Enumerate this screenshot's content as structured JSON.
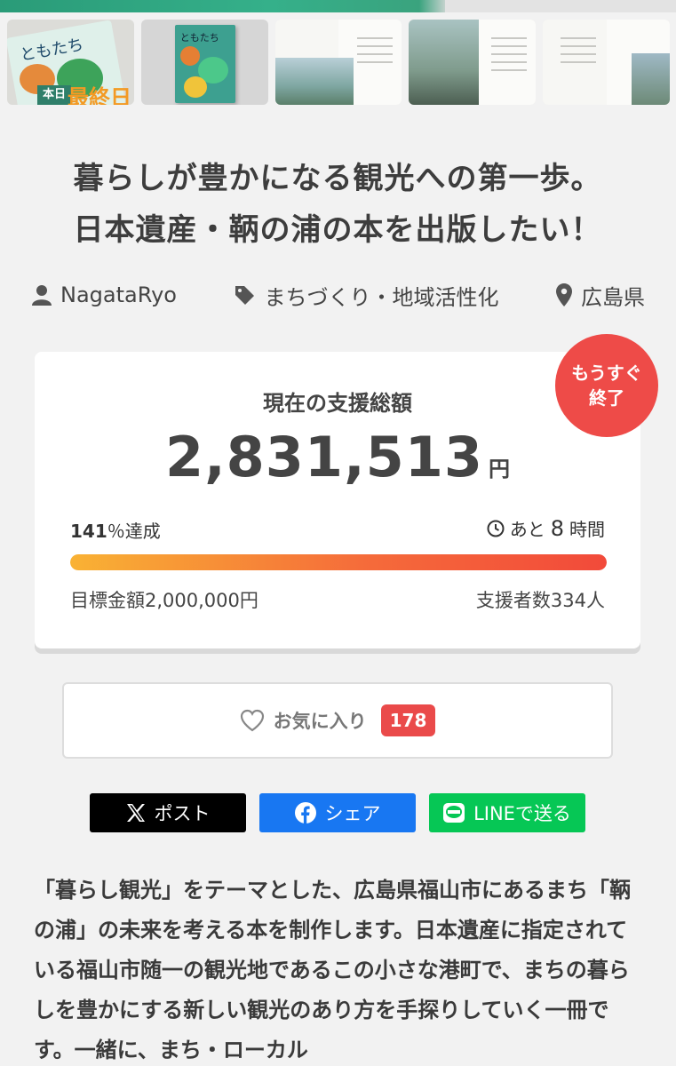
{
  "thumbnails": [
    {
      "title": "ともたち",
      "badge": "本日",
      "badge_big": "最終日"
    },
    {
      "title": "ともたち"
    },
    {},
    {},
    {}
  ],
  "title": {
    "line1": "暮らしが豊かになる観光への第一歩。",
    "line2": "日本遺産・鞆の浦の本を出版したい！"
  },
  "meta": {
    "author": "NagataRyo",
    "category": "まちづくり・地域活性化",
    "location": "広島県"
  },
  "funding": {
    "label": "現在の支援総額",
    "amount": "2,831,513",
    "unit": "円",
    "percent_value": "141",
    "percent_suffix": "％達成",
    "progress": 1.0,
    "remaining_prefix": "あと",
    "remaining_value": "8",
    "remaining_suffix": "時間",
    "goal": "目標金額2,000,000円",
    "backers": "支援者数334人",
    "ending_badge_line1": "もうすぐ",
    "ending_badge_line2": "終了"
  },
  "favorite": {
    "label": "お気に入り",
    "count": "178"
  },
  "share": {
    "x_label": "ポスト",
    "facebook_label": "シェア",
    "line_label": "LINEで送る"
  },
  "description": {
    "text": "「暮らし観光」をテーマとした、広島県福山市にあるまち「鞆の浦」の未来を考える本を制作します。日本遺産に指定されている福山市随一の観光地であるこの小さな港町で、まちの暮らしを豊かにする新しい観光のあり方を手探りしていく一冊です。一緒に、まち・ローカル"
  },
  "colors": {
    "accent_red": "#ee4b48",
    "progress_start": "#f9b234",
    "progress_end": "#f24a3a",
    "x_black": "#000000",
    "facebook_blue": "#1877f2",
    "line_green": "#06c755"
  }
}
